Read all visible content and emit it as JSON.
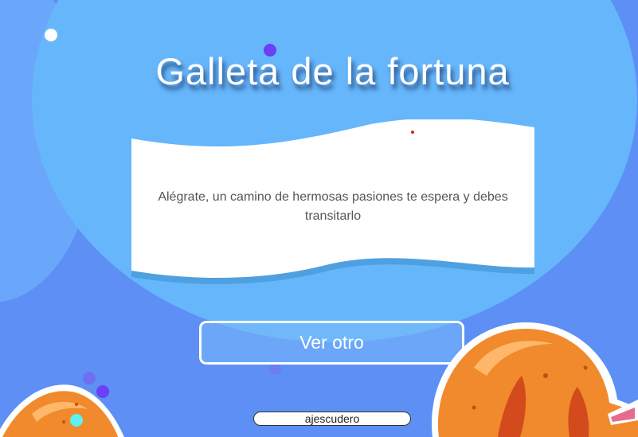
{
  "page": {
    "title": "Galleta de la fortuna",
    "fortune_message": "Alégrate, un camino de hermosas pasiones te espera y debes transitarlo",
    "button_label": "Ver otro",
    "author": "ajescudero"
  },
  "colors": {
    "background": "#5d8ff5",
    "light_blue": "#66b6fb",
    "paper": "#ffffff",
    "paper_shadow": "#4fa0e0",
    "cookie_orange": "#f08a2c",
    "cookie_highlight": "#ffb86a",
    "cookie_inner": "#d34a1c",
    "dot_purple": "#6a3ff5",
    "dot_cyan": "#5ff0f0"
  },
  "icons": [
    "fortune-cookie-icon"
  ]
}
